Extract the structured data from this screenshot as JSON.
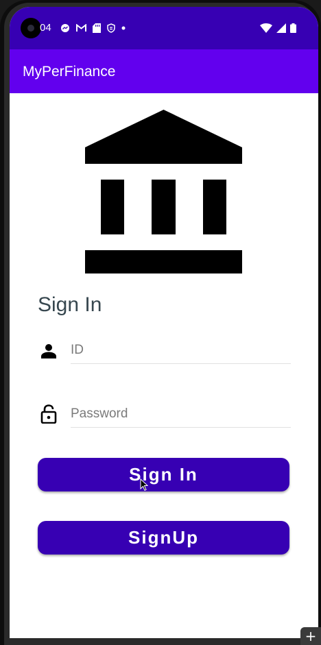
{
  "status_bar": {
    "time": "04",
    "notification_icons": [
      "messenger-icon",
      "gmail-icon",
      "sd-card-icon",
      "shield-icon",
      "dot-icon"
    ],
    "system_icons": [
      "wifi-icon",
      "signal-icon",
      "battery-icon"
    ]
  },
  "app_bar": {
    "title": "MyPerFinance"
  },
  "logo": {
    "icon": "bank-icon"
  },
  "form": {
    "title": "Sign In",
    "id_field": {
      "icon": "person-icon",
      "placeholder": "ID",
      "value": ""
    },
    "password_field": {
      "icon": "lock-open-icon",
      "placeholder": "Password",
      "value": ""
    },
    "sign_in_label": "Sign In",
    "sign_up_label": "SignUp"
  },
  "colors": {
    "status_bar": "#3700b3",
    "app_bar": "#6200ee",
    "button": "#3700b3",
    "title_text": "#37474f"
  }
}
